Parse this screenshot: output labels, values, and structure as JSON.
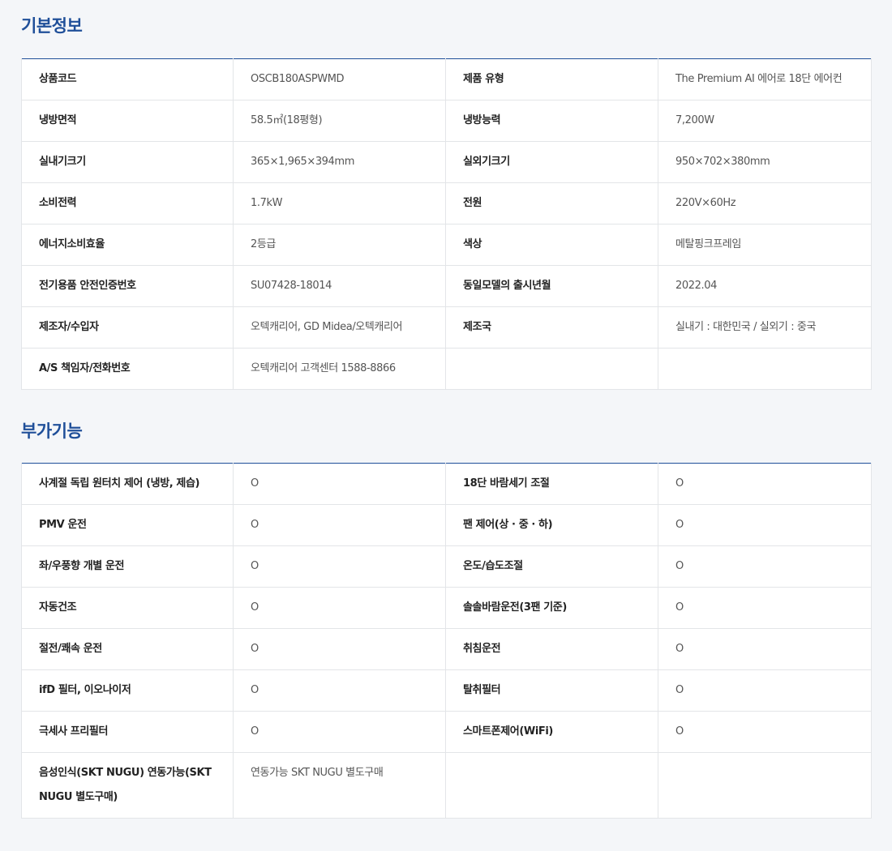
{
  "basic": {
    "title": "기본정보",
    "rows": [
      {
        "k1": "상품코드",
        "v1": "OSCB180ASPWMD",
        "k2": "제품 유형",
        "v2": "The Premium AI 에어로 18단 에어컨"
      },
      {
        "k1": "냉방면적",
        "v1": "58.5㎡(18평형)",
        "k2": "냉방능력",
        "v2": "7,200W"
      },
      {
        "k1": "실내기크기",
        "v1": "365×1,965×394mm",
        "k2": "실외기크기",
        "v2": "950×702×380mm"
      },
      {
        "k1": "소비전력",
        "v1": "1.7kW",
        "k2": "전원",
        "v2": "220V×60Hz"
      },
      {
        "k1": "에너지소비효율",
        "v1": "2등급",
        "k2": "색상",
        "v2": "메탈핑크프레임"
      },
      {
        "k1": "전기용품 안전인증번호",
        "v1": "SU07428-18014",
        "k2": "동일모델의 출시년월",
        "v2": "2022.04"
      },
      {
        "k1": "제조자/수입자",
        "v1": "오텍캐리어, GD Midea/오텍캐리어",
        "k2": "제조국",
        "v2": "실내기 : 대한민국 / 실외기 : 중국"
      },
      {
        "k1": "A/S 책임자/전화번호",
        "v1": "오텍캐리어 고객센터 1588-8866",
        "k2": "",
        "v2": ""
      }
    ]
  },
  "extra": {
    "title": "부가기능",
    "rows": [
      {
        "k1": "사계절 독립 원터치 제어 (냉방, 제습)",
        "v1": "O",
        "k2": "18단 바람세기 조절",
        "v2": "O"
      },
      {
        "k1": "PMV 운전",
        "v1": "O",
        "k2": "팬 제어(상 · 중 · 하)",
        "v2": "O"
      },
      {
        "k1": "좌/우풍향 개별 운전",
        "v1": "O",
        "k2": "온도/습도조절",
        "v2": "O"
      },
      {
        "k1": "자동건조",
        "v1": "O",
        "k2": "솔솔바람운전(3팬 기준)",
        "v2": "O"
      },
      {
        "k1": "절전/쾌속 운전",
        "v1": "O",
        "k2": "취침운전",
        "v2": "O"
      },
      {
        "k1": "ifD 필터, 이오나이저",
        "v1": "O",
        "k2": "탈취필터",
        "v2": "O"
      },
      {
        "k1": "극세사 프리필터",
        "v1": "O",
        "k2": "스마트폰제어(WiFi)",
        "v2": "O"
      },
      {
        "k1": "음성인식(SKT NUGU) 연동가능(SKT NUGU 별도구매)",
        "v1": "연동가능 SKT NUGU 별도구매",
        "k2": "",
        "v2": ""
      }
    ]
  }
}
